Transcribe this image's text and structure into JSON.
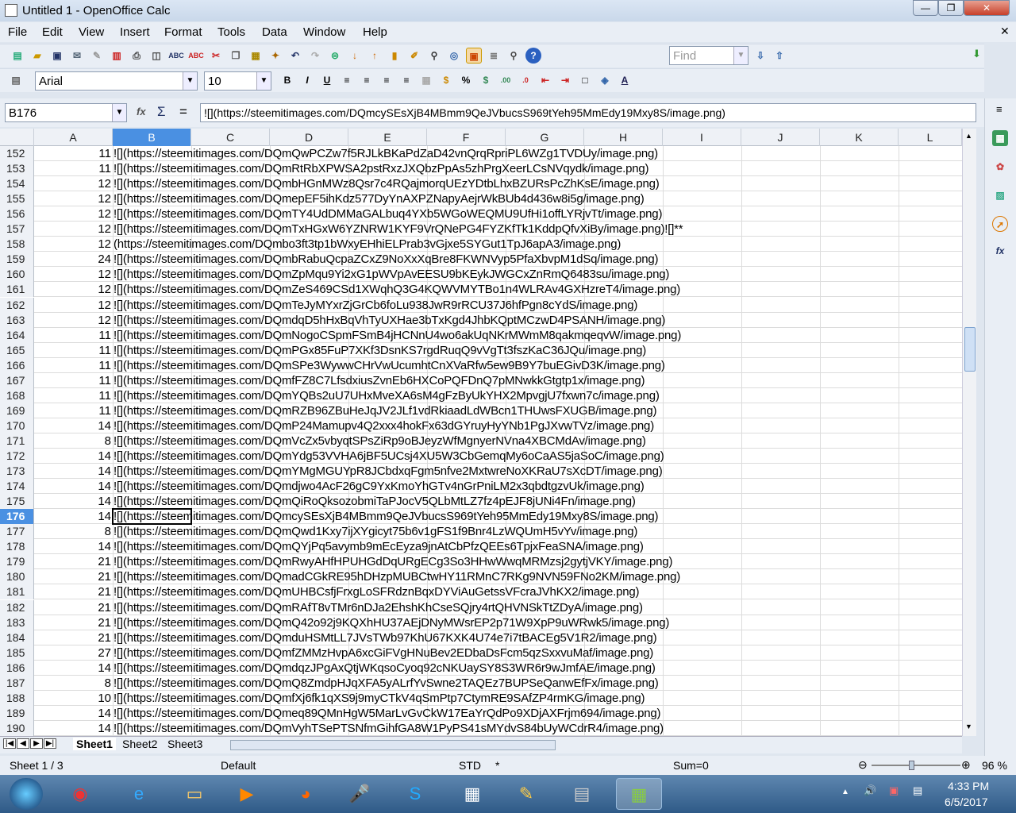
{
  "window": {
    "title": "Untitled 1 - OpenOffice Calc",
    "minimize": "—",
    "restore": "❐",
    "close": "✕"
  },
  "menu": [
    "File",
    "Edit",
    "View",
    "Insert",
    "Format",
    "Tools",
    "Data",
    "Window",
    "Help"
  ],
  "toolbar": {
    "find_placeholder": "Find",
    "font_name": "Arial",
    "font_size": "10"
  },
  "formula_bar": {
    "cell_ref": "B176",
    "function_wizard": "fx",
    "sum": "Σ",
    "equals": "=",
    "content": "![](https://steemitimages.com/DQmcySEsXjB4MBmm9QeJVbucsS969tYeh95MmEdy19Mxy8S/image.png)"
  },
  "columns": [
    "A",
    "B",
    "C",
    "D",
    "E",
    "F",
    "G",
    "H",
    "I",
    "J",
    "K",
    "L"
  ],
  "selected_column": "B",
  "selected_row": "176",
  "rows": [
    {
      "n": "152",
      "a": "11",
      "b": "![](https://steemitimages.com/DQmQwPCZw7f5RJLkBKaPdZaD42vnQrqRpriPL6WZg1TVDUy/image.png)"
    },
    {
      "n": "153",
      "a": "11",
      "b": "![](https://steemitimages.com/DQmRtRbXPWSA2pstRxzJXQbzPpAs5zhPrgXeerLCsNVqydk/image.png)"
    },
    {
      "n": "154",
      "a": "12",
      "b": "![](https://steemitimages.com/DQmbHGnMWz8Qsr7c4RQajmorqUEzYDtbLhxBZURsPcZhKsE/image.png)"
    },
    {
      "n": "155",
      "a": "12",
      "b": "![](https://steemitimages.com/DQmepEF5ihKdz577DyYnAXPZNapyAejrWkBUb4d436w8i5g/image.png)"
    },
    {
      "n": "156",
      "a": "12",
      "b": "![](https://steemitimages.com/DQmTY4UdDMMaGALbuq4YXb5WGoWEQMU9UfHi1offLYRjvTt/image.png)"
    },
    {
      "n": "157",
      "a": "12",
      "b": "![](https://steemitimages.com/DQmTxHGxW6YZNRW1KYF9VrQNePG4FYZKfTk1KddpQfvXiBy/image.png)![]**"
    },
    {
      "n": "158",
      "a": "12",
      "b": "(https://steemitimages.com/DQmbo3ft3tp1bWxyEHhiELPrab3vGjxe5SYGut1TpJ6apA3/image.png)"
    },
    {
      "n": "159",
      "a": "24",
      "b": "![](https://steemitimages.com/DQmbRabuQcpaZCxZ9NoXxXqBre8FKWNVyp5PfaXbvpM1dSq/image.png)"
    },
    {
      "n": "160",
      "a": "12",
      "b": "![](https://steemitimages.com/DQmZpMqu9Yi2xG1pWVpAvEESU9bKEykJWGCxZnRmQ6483su/image.png)"
    },
    {
      "n": "161",
      "a": "12",
      "b": "![](https://steemitimages.com/DQmZeS469CSd1XWqhQ3G4KQWVMYTBo1n4WLRAv4GXHzreT4/image.png)"
    },
    {
      "n": "162",
      "a": "12",
      "b": "![](https://steemitimages.com/DQmTeJyMYxrZjGrCb6foLu938JwR9rRCU37J6hfPgn8cYdS/image.png)"
    },
    {
      "n": "163",
      "a": "12",
      "b": "![](https://steemitimages.com/DQmdqD5hHxBqVhTyUXHae3bTxKgd4JhbKQptMCzwD4PSANH/image.png)"
    },
    {
      "n": "164",
      "a": "11",
      "b": "![](https://steemitimages.com/DQmNogoCSpmFSmB4jHCNnU4wo6akUqNKrMWmM8qakmqeqvW/image.png)"
    },
    {
      "n": "165",
      "a": "11",
      "b": "![](https://steemitimages.com/DQmPGx85FuP7XKf3DsnKS7rgdRuqQ9vVgTt3fszKaC36JQu/image.png)"
    },
    {
      "n": "166",
      "a": "11",
      "b": "![](https://steemitimages.com/DQmSPe3WywwCHrVwUcumhtCnXVaRfw5ew9B9Y7buEGivD3K/image.png)"
    },
    {
      "n": "167",
      "a": "11",
      "b": "![](https://steemitimages.com/DQmfFZ8C7LfsdxiusZvnEb6HXCoPQFDnQ7pMNwkkGtgtp1x/image.png)"
    },
    {
      "n": "168",
      "a": "11",
      "b": "![](https://steemitimages.com/DQmYQBs2uU7UHxMveXA6sM4gFzByUkYHX2MpvgjU7fxwn7c/image.png)"
    },
    {
      "n": "169",
      "a": "11",
      "b": "![](https://steemitimages.com/DQmRZB96ZBuHeJqJV2JLf1vdRkiaadLdWBcn1THUwsFXUGB/image.png)"
    },
    {
      "n": "170",
      "a": "14",
      "b": "![](https://steemitimages.com/DQmP24Mamupv4Q2xxx4hokFx63dGYruyHyYNb1PgJXvwTVz/image.png)"
    },
    {
      "n": "171",
      "a": "8",
      "b": "![](https://steemitimages.com/DQmVcZx5vbyqtSPsZiRp9oBJeyzWfMgnyerNVna4XBCMdAv/image.png)"
    },
    {
      "n": "172",
      "a": "14",
      "b": "![](https://steemitimages.com/DQmYdg53VVHA6jBF5UCsj4XU5W3CbGemqMy6oCaAS5jaSoC/image.png)"
    },
    {
      "n": "173",
      "a": "14",
      "b": "![](https://steemitimages.com/DQmYMgMGUYpR8JCbdxqFgm5nfve2MxtwreNoXKRaU7sXcDT/image.png)"
    },
    {
      "n": "174",
      "a": "14",
      "b": "![](https://steemitimages.com/DQmdjwo4AcF26gC9YxKmoYhGTv4nGrPniLM2x3qbdtgzvUk/image.png)"
    },
    {
      "n": "175",
      "a": "14",
      "b": "![](https://steemitimages.com/DQmQiRoQksozobmiTaPJocV5QLbMtLZ7fz4pEJF8jUNi4Fn/image.png)"
    },
    {
      "n": "176",
      "a": "14",
      "b": "![](https://steemitimages.com/DQmcySEsXjB4MBmm9QeJVbucsS969tYeh95MmEdy19Mxy8S/image.png)"
    },
    {
      "n": "177",
      "a": "8",
      "b": "![](https://steemitimages.com/DQmQwd1Kxy7ijXYgicyt75b6v1gFS1f9Bnr4LzWQUmH5vYv/image.png)"
    },
    {
      "n": "178",
      "a": "14",
      "b": "![](https://steemitimages.com/DQmQYjPq5avymb9mEcEyza9jnAtCbPfzQEEs6TpjxFeaSNA/image.png)"
    },
    {
      "n": "179",
      "a": "21",
      "b": "![](https://steemitimages.com/DQmRwyAHfHPUHGdDqURgECg3So3HHwWwqMRMzsj2gytjVKY/image.png)"
    },
    {
      "n": "180",
      "a": "21",
      "b": "![](https://steemitimages.com/DQmadCGkRE95hDHzpMUBCtwHY11RMnC7RKg9NVN59FNo2KM/image.png)"
    },
    {
      "n": "181",
      "a": "21",
      "b": "![](https://steemitimages.com/DQmUHBCsfjFrxgLoSFRdznBqxDYViAuGetssVFcraJVhKX2/image.png)"
    },
    {
      "n": "182",
      "a": "21",
      "b": "![](https://steemitimages.com/DQmRAfT8vTMr6nDJa2EhshKhCseSQjry4rtQHVNSkTtZDyA/image.png)"
    },
    {
      "n": "183",
      "a": "21",
      "b": "![](https://steemitimages.com/DQmQ42o92j9KQXhHU37AEjDNyMWsrEP2p71W9XpP9uWRwk5/image.png)"
    },
    {
      "n": "184",
      "a": "21",
      "b": "![](https://steemitimages.com/DQmduHSMtLL7JVsTWb97KhU67KXK4U74e7i7tBACEg5V1R2/image.png)"
    },
    {
      "n": "185",
      "a": "27",
      "b": "![](https://steemitimages.com/DQmfZMMzHvpA6xcGiFVgHNuBev2EDbaDsFcm5qzSxxvuMaf/image.png)"
    },
    {
      "n": "186",
      "a": "14",
      "b": "![](https://steemitimages.com/DQmdqzJPgAxQtjWKqsoCyoq92cNKUaySY8S3WR6r9wJmfAE/image.png)"
    },
    {
      "n": "187",
      "a": "8",
      "b": "![](https://steemitimages.com/DQmQ8ZmdpHJqXFA5yALrfYvSwne2TAQEz7BUPSeQanwEfFx/image.png)"
    },
    {
      "n": "188",
      "a": "10",
      "b": "![](https://steemitimages.com/DQmfXj6fk1qXS9j9myCTkV4qSmPtp7CtymRE9SAfZP4rmKG/image.png)"
    },
    {
      "n": "189",
      "a": "14",
      "b": "![](https://steemitimages.com/DQmeq89QMnHgW5MarLvGvCkW17EaYrQdPo9XDjAXFrjm694/image.png)"
    },
    {
      "n": "190",
      "a": "14",
      "b": "![](https://steemitimages.com/DQmVyhTSePTSNfmGihfGA8W1PyPS41sMYdvS84bUyWCdrR4/image.png)"
    }
  ],
  "sheet_tabs": [
    "Sheet1",
    "Sheet2",
    "Sheet3"
  ],
  "status": {
    "sheet": "Sheet 1 / 3",
    "page_style": "Default",
    "mode": "STD",
    "modified": "*",
    "sum": "Sum=0",
    "zoom": "96 %"
  },
  "taskbar": {
    "time": "4:33 PM",
    "date": "6/5/2017"
  }
}
